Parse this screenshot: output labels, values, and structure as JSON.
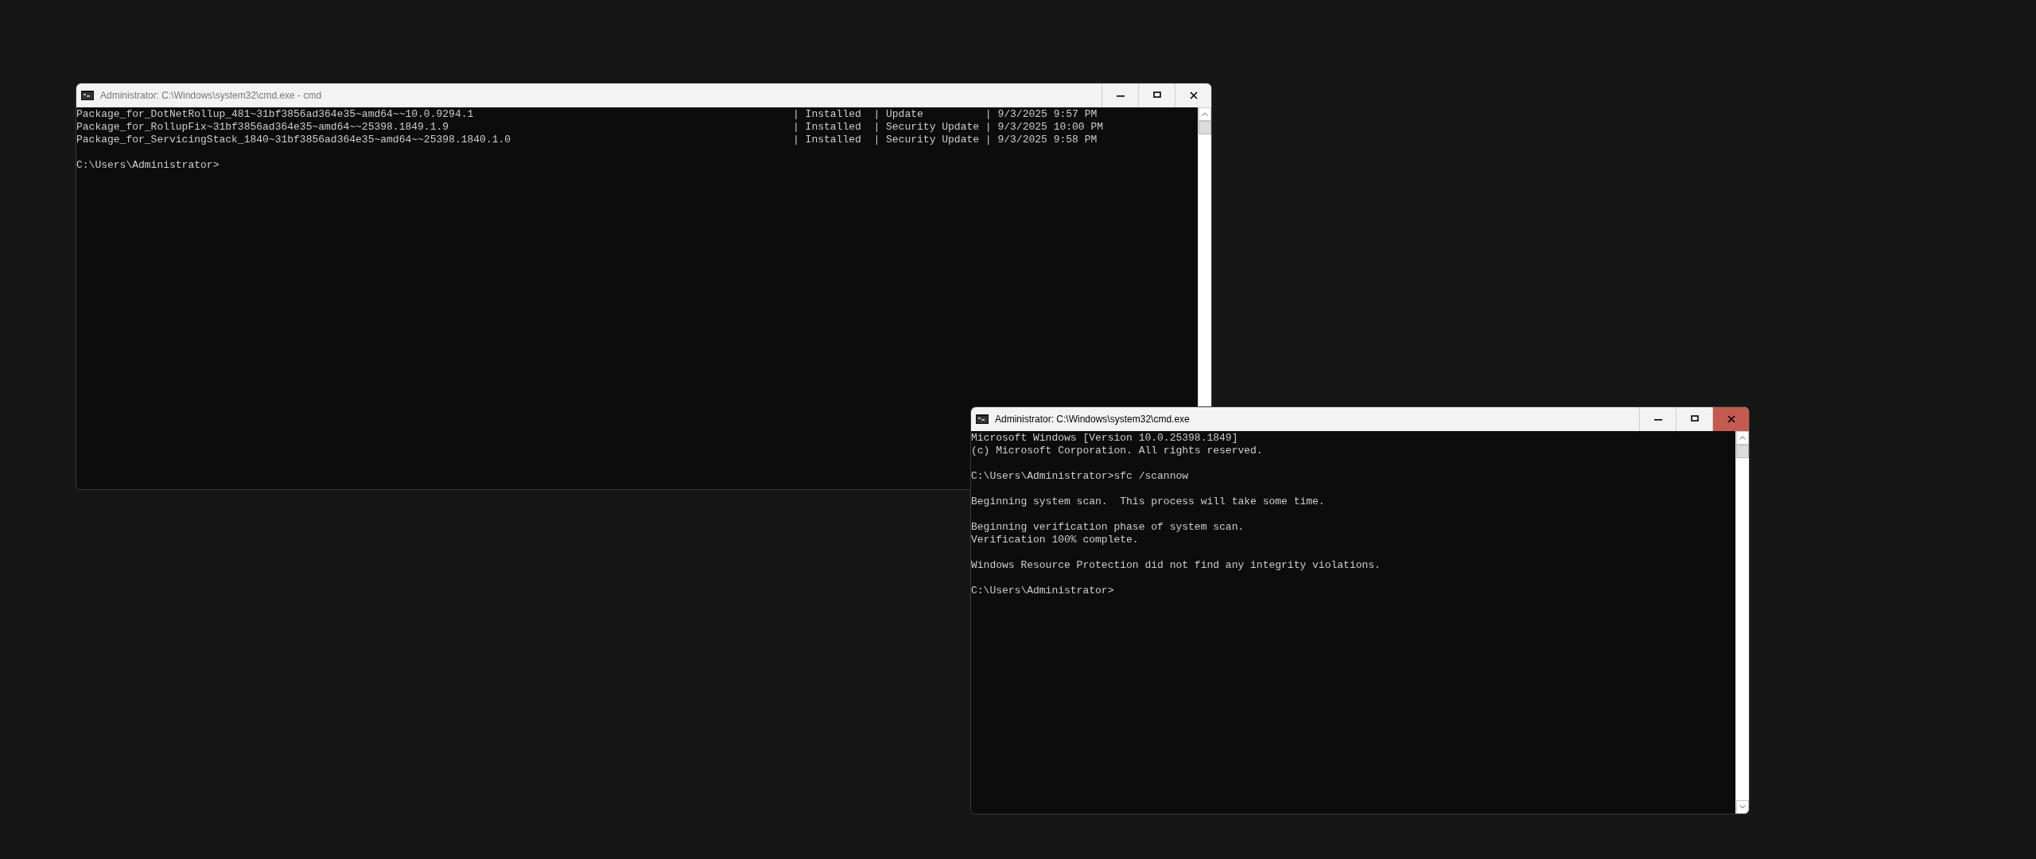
{
  "windows": [
    {
      "title": "Administrator: C:\\Windows\\system32\\cmd.exe - cmd",
      "active": false,
      "close_highlighted": false,
      "paragraphs": [
        {
          "lines": [
            {
              "text": "Package_for_DotNetRollup_481~31bf3856ad364e35~amd64~~10.0.9294.1",
              "details": "| Installed  | Update          | 9/3/2025 9:57 PM"
            },
            {
              "text": "Package_for_RollupFix~31bf3856ad364e35~amd64~~25398.1849.1.9",
              "details": "| Installed  | Security Update | 9/3/2025 10:00 PM"
            },
            {
              "text": "Package_for_ServicingStack_1840~31bf3856ad364e35~amd64~~25398.1840.1.0",
              "details": "| Installed  | Security Update | 9/3/2025 9:58 PM"
            }
          ]
        },
        {
          "lines": [
            {
              "text": "C:\\Users\\Administrator>"
            }
          ]
        }
      ]
    },
    {
      "title": "Administrator: C:\\Windows\\system32\\cmd.exe",
      "active": true,
      "close_highlighted": true,
      "paragraphs": [
        {
          "lines": [
            {
              "text": "Microsoft Windows [Version 10.0.25398.1849]"
            },
            {
              "text": "(c) Microsoft Corporation. All rights reserved."
            }
          ]
        },
        {
          "lines": [
            {
              "text": "C:\\Users\\Administrator>sfc /scannow"
            }
          ]
        },
        {
          "lines": [
            {
              "text": "Beginning system scan.  This process will take some time."
            }
          ]
        },
        {
          "lines": [
            {
              "text": "Beginning verification phase of system scan."
            },
            {
              "text": "Verification 100% complete."
            }
          ]
        },
        {
          "lines": [
            {
              "text": "Windows Resource Protection did not find any integrity violations."
            }
          ]
        },
        {
          "lines": [
            {
              "text": "C:\\Users\\Administrator>"
            }
          ]
        }
      ]
    }
  ]
}
